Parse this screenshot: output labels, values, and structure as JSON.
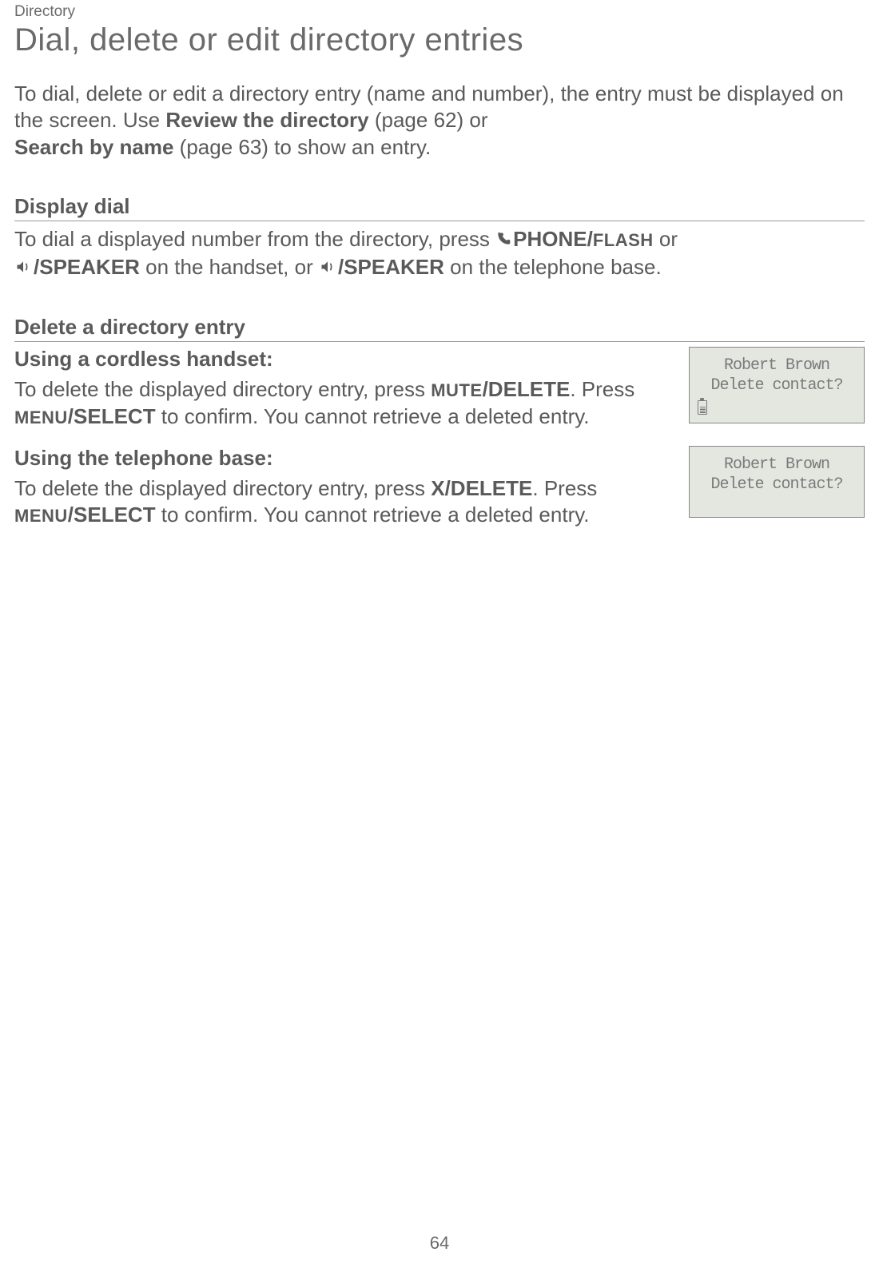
{
  "breadcrumb": "Directory",
  "title": "Dial, delete or edit directory entries",
  "intro": {
    "line1_pre": "To dial, delete or edit a directory entry (name and number), the entry must be displayed on the screen. Use ",
    "review_bold": "Review the directory",
    "review_page": " (page 62) ",
    "or": "or ",
    "search_bold": "Search by name",
    "search_page": " (page 63) to show an entry."
  },
  "display_dial": {
    "heading": "Display dial",
    "pre": "To dial a displayed number from the directory, press ",
    "phone_bold": "PHONE/",
    "flash_small": "FLASH",
    "or": " or ",
    "speaker1": "/SPEAKER",
    "mid": " on the handset, or ",
    "speaker2": "/SPEAKER",
    "end": " on the telephone base."
  },
  "delete_entry": {
    "heading": "Delete a directory entry",
    "handset": {
      "subheading": "Using a cordless handset:",
      "pre": "To delete the displayed directory entry, press ",
      "mute_small": "MUTE",
      "delete_bold": "/DELETE",
      "period": ". Press ",
      "menu_small": "MENU",
      "select_bold": "/SELECT",
      "end": " to confirm. You cannot retrieve a deleted entry."
    },
    "base": {
      "subheading": "Using the telephone base:",
      "pre": "To delete the displayed directory entry, press ",
      "xdelete_bold": "X/DELETE",
      "period": ". Press ",
      "menu_small": "MENU",
      "select_bold": "/SELECT",
      "end": " to confirm. You cannot retrieve a deleted entry."
    }
  },
  "lcd1": {
    "line1": "Robert Brown",
    "line2": "Delete contact?"
  },
  "lcd2": {
    "line1": "Robert Brown",
    "line2": "Delete contact?"
  },
  "page_number": "64"
}
